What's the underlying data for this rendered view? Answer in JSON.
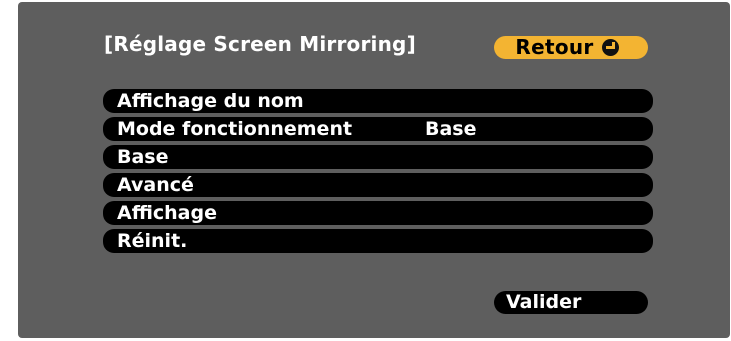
{
  "dialog": {
    "title": "[Réglage Screen Mirroring]",
    "back_label": "Retour",
    "back_icon": "enter-icon"
  },
  "menu": {
    "items": [
      {
        "label": "Affichage du nom",
        "value": ""
      },
      {
        "label": "Mode fonctionnement",
        "value": "Base"
      },
      {
        "label": "Base",
        "value": ""
      },
      {
        "label": "Avancé",
        "value": ""
      },
      {
        "label": "Affichage",
        "value": ""
      },
      {
        "label": "Réinit.",
        "value": ""
      }
    ]
  },
  "footer": {
    "ok_label": "Valider"
  },
  "colors": {
    "panel": "#5e5e5e",
    "accent": "#f3b432",
    "item": "#000000",
    "text": "#ffffff"
  }
}
